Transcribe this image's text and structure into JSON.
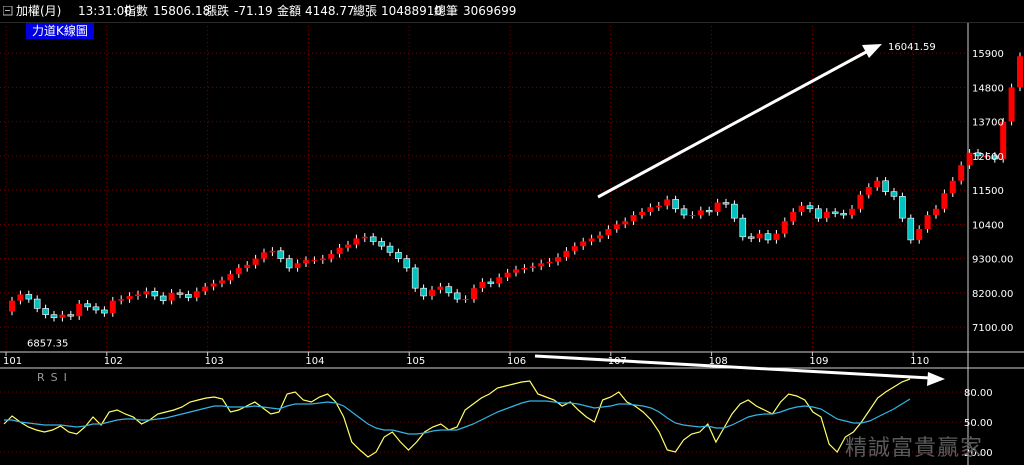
{
  "header": {
    "title": "加權(月)",
    "time": "13:31:00",
    "index_label": "指數",
    "index_value": "15806.18",
    "change_label": "漲跌",
    "change_value": "-71.19",
    "amount_label": "金額",
    "amount_value": "4148.77",
    "volume_label": "總張",
    "volume_value": "10488910",
    "trades_label": "總筆",
    "trades_value": "3069699"
  },
  "indicator_tag": "力道K線圖",
  "rsi_label": "RSI",
  "watermark": "精誠富貴贏家",
  "colors": {
    "up": "#ff0000",
    "down": "#00c0c0",
    "rsi_fast": "#ffff66",
    "rsi_slow": "#33b5e5",
    "arrow": "#ffffff",
    "grid": "#7a0000"
  },
  "chart_data": [
    {
      "type": "candlestick",
      "x_tick_labels": [
        "101",
        "102",
        "103",
        "104",
        "105",
        "106",
        "107",
        "108",
        "109",
        "110"
      ],
      "y_tick_labels": [
        "7100.00",
        "8200.00",
        "9300.00",
        "10400",
        "11500",
        "12600",
        "13700",
        "14800",
        "15900"
      ],
      "ylim": [
        6300,
        16900
      ],
      "annotations": [
        "6857.35",
        "16041.59"
      ],
      "grid": true,
      "close": [
        7950,
        8150,
        8000,
        7700,
        7500,
        7400,
        7500,
        7450,
        7850,
        7750,
        7650,
        7550,
        7950,
        8000,
        8100,
        8150,
        8250,
        8100,
        7950,
        8200,
        8150,
        8050,
        8250,
        8400,
        8500,
        8600,
        8800,
        9000,
        9100,
        9300,
        9500,
        9550,
        9300,
        9000,
        9150,
        9250,
        9250,
        9300,
        9450,
        9650,
        9750,
        9950,
        10000,
        9850,
        9700,
        9500,
        9300,
        9000,
        8350,
        8100,
        8300,
        8400,
        8200,
        8000,
        8000,
        8350,
        8550,
        8500,
        8700,
        8850,
        8950,
        9000,
        9050,
        9150,
        9200,
        9350,
        9550,
        9700,
        9850,
        9950,
        10050,
        10250,
        10400,
        10500,
        10700,
        10800,
        10950,
        11000,
        11200,
        10900,
        10700,
        10700,
        10850,
        10800,
        11100,
        11050,
        10600,
        10000,
        9950,
        10100,
        9900,
        10100,
        10500,
        10800,
        11000,
        10900,
        10600,
        10800,
        10750,
        10700,
        10900,
        11350,
        11600,
        11800,
        11450,
        11300,
        10600,
        9900,
        10250,
        10700,
        10900,
        11400,
        11800,
        12300,
        12700,
        12600,
        12600,
        12500,
        13700,
        14800,
        15800
      ],
      "open": [
        7600,
        7950,
        8150,
        8000,
        7700,
        7500,
        7400,
        7500,
        7450,
        7850,
        7750,
        7650,
        7550,
        7950,
        8000,
        8100,
        8150,
        8250,
        8100,
        7950,
        8200,
        8150,
        8050,
        8250,
        8400,
        8500,
        8600,
        8800,
        9000,
        9100,
        9300,
        9500,
        9550,
        9300,
        9000,
        9150,
        9250,
        9250,
        9300,
        9450,
        9650,
        9750,
        9950,
        10000,
        9850,
        9700,
        9500,
        9300,
        9000,
        8350,
        8100,
        8300,
        8400,
        8200,
        8000,
        8000,
        8350,
        8550,
        8500,
        8700,
        8850,
        8950,
        9000,
        9050,
        9150,
        9200,
        9350,
        9550,
        9700,
        9850,
        9950,
        10050,
        10250,
        10400,
        10500,
        10700,
        10800,
        10950,
        11000,
        11200,
        10900,
        10700,
        10700,
        10850,
        10800,
        11100,
        11050,
        10600,
        10000,
        9950,
        10100,
        9900,
        10100,
        10500,
        10800,
        11000,
        10900,
        10600,
        10800,
        10750,
        10700,
        10900,
        11350,
        11600,
        11800,
        11450,
        11300,
        10600,
        9900,
        10250,
        10700,
        10900,
        11400,
        11800,
        12300,
        12700,
        12600,
        12600,
        12500,
        13700,
        14800
      ]
    },
    {
      "type": "line",
      "title": "",
      "y_tick_labels": [
        "80.00",
        "50.00",
        "20.00"
      ],
      "ylim": [
        10,
        100
      ],
      "series": [
        {
          "values": [
            48,
            56,
            50,
            45,
            42,
            40,
            42,
            46,
            40,
            38,
            45,
            55,
            47,
            60,
            62,
            58,
            55,
            48,
            52,
            58,
            60,
            62,
            65,
            70,
            72,
            74,
            75,
            73,
            60,
            62,
            66,
            70,
            64,
            58,
            60,
            78,
            80,
            72,
            70,
            75,
            78,
            70,
            55,
            30,
            22,
            15,
            20,
            35,
            40,
            30,
            22,
            30,
            40,
            45,
            48,
            42,
            45,
            62,
            68,
            74,
            78,
            84,
            86,
            88,
            90,
            91,
            78,
            75,
            72,
            66,
            70,
            62,
            55,
            50,
            72,
            75,
            80,
            70,
            66,
            60,
            52,
            40,
            22,
            20,
            32,
            38,
            40,
            48,
            30,
            44,
            58,
            68,
            72,
            66,
            62,
            58,
            70,
            78,
            76,
            72,
            60,
            55,
            28,
            20,
            35,
            40,
            50,
            62,
            74,
            80,
            85,
            90,
            93
          ]
        },
        {
          "values": [
            52,
            52,
            50,
            49,
            48,
            47,
            47,
            47,
            46,
            45,
            46,
            48,
            48,
            50,
            52,
            53,
            53,
            52,
            52,
            53,
            54,
            56,
            58,
            60,
            62,
            64,
            66,
            66,
            65,
            65,
            65,
            66,
            65,
            64,
            63,
            66,
            68,
            68,
            68,
            69,
            70,
            69,
            66,
            60,
            54,
            48,
            44,
            42,
            42,
            40,
            38,
            38,
            39,
            41,
            42,
            42,
            42,
            45,
            48,
            52,
            56,
            60,
            63,
            66,
            69,
            71,
            71,
            71,
            70,
            69,
            69,
            68,
            66,
            64,
            65,
            66,
            68,
            68,
            67,
            66,
            64,
            60,
            54,
            49,
            47,
            46,
            45,
            46,
            44,
            44,
            47,
            51,
            55,
            57,
            58,
            58,
            60,
            63,
            65,
            66,
            65,
            63,
            58,
            53,
            51,
            49,
            49,
            51,
            55,
            59,
            63,
            68,
            73
          ]
        }
      ]
    }
  ]
}
